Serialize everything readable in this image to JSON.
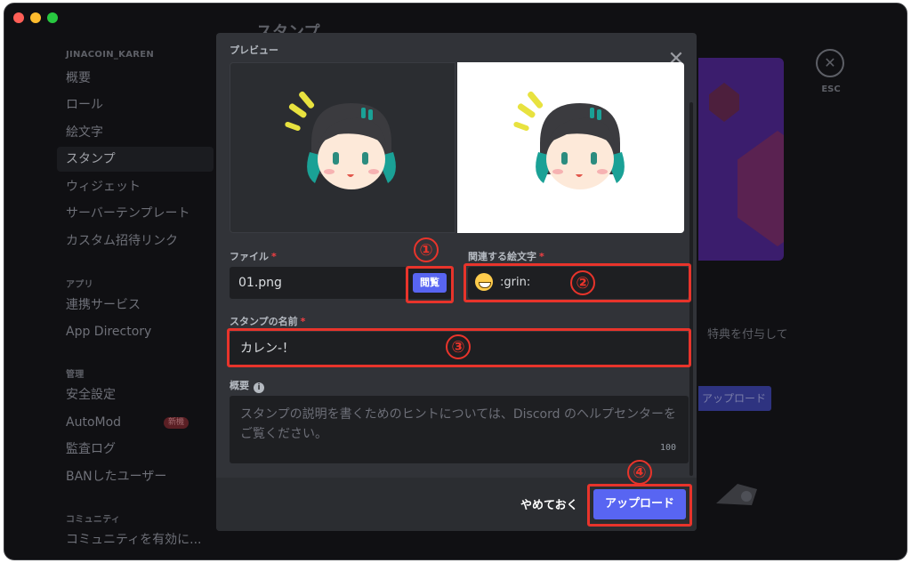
{
  "sidebar": {
    "server_header": "JINACOIN_KAREN",
    "items_server": [
      "概要",
      "ロール",
      "絵文字",
      "スタンプ",
      "ウィジェット",
      "サーバーテンプレート",
      "カスタム招待リンク"
    ],
    "apps_header": "アプリ",
    "items_apps": [
      "連携サービス",
      "App Directory"
    ],
    "moderation_header": "管理",
    "items_moderation": [
      "安全設定",
      "AutoMod",
      "監査ログ",
      "BANしたユーザー"
    ],
    "automod_badge": "新機",
    "community_header": "コミュニティ",
    "items_community": [
      "コミュニティを有効に..."
    ]
  },
  "background": {
    "page_title": "スタンプ",
    "partial_text": "特典を付与して",
    "partial_upload_button": "アップロード",
    "esc_label": "ESC"
  },
  "modal": {
    "preview_label": "プレビュー",
    "file_label": "ファイル",
    "file_value": "01.png",
    "browse_label": "閲覧",
    "emoji_label": "関連する絵文字",
    "emoji_value": ":grin:",
    "name_label": "スタンプの名前",
    "name_value": "カレン-！",
    "desc_label": "概要",
    "desc_placeholder": "スタンプの説明を書くためのヒントについては、Discord のヘルプセンターをご覧ください。",
    "desc_counter": "100",
    "cancel_label": "やめておく",
    "upload_label": "アップロード"
  },
  "annotations": {
    "step1": "①",
    "step2": "②",
    "step3": "③",
    "step4": "④",
    "color": "#e8342b"
  }
}
